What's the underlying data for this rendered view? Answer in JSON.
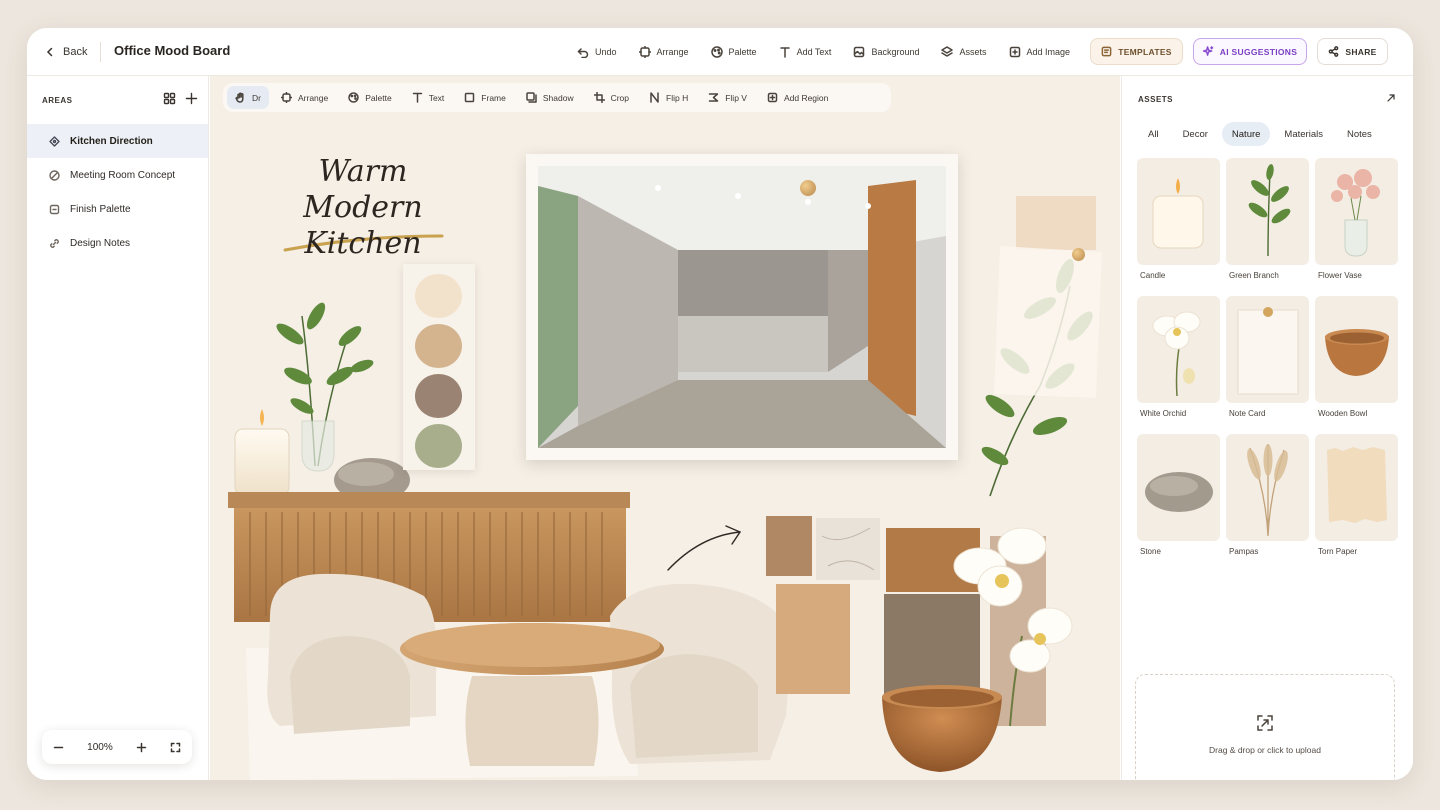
{
  "header": {
    "back_label": "Back",
    "title": "Office Mood Board",
    "tools": [
      {
        "label": "Undo",
        "icon": "undo-icon"
      },
      {
        "label": "Arrange",
        "icon": "arrange-icon"
      },
      {
        "label": "Palette",
        "icon": "palette-icon"
      },
      {
        "label": "Add Text",
        "icon": "text-icon"
      },
      {
        "label": "Background",
        "icon": "background-icon"
      },
      {
        "label": "Assets",
        "icon": "assets-icon"
      },
      {
        "label": "Add Image",
        "icon": "image-icon"
      }
    ],
    "templates_label": "TEMPLATES",
    "ai_label": "AI SUGGESTIONS",
    "share_label": "SHARE"
  },
  "left": {
    "areas_label": "AREAS",
    "items": [
      {
        "label": "Kitchen Direction",
        "active": true
      },
      {
        "label": "Meeting Room Concept"
      },
      {
        "label": "Finish Palette"
      },
      {
        "label": "Design Notes"
      }
    ],
    "zoom_label": "100%"
  },
  "canvas": {
    "tools": [
      "Dr",
      "Arrange",
      "Palette",
      "Text",
      "Frame",
      "Shadow",
      "Crop",
      "Flip H",
      "Flip V",
      "Add Region"
    ],
    "board_title_line1": "Warm Modern",
    "board_title_line2": "Kitchen",
    "swatches": [
      "#f3e2cb",
      "#d4b48f",
      "#9a8372",
      "#a8ae8b"
    ]
  },
  "right": {
    "assets_label": "ASSETS",
    "tabs": [
      "All",
      "Decor",
      "Nature",
      "Materials",
      "Notes"
    ],
    "active_tab": "Nature",
    "assets": [
      "Candle",
      "Green Branch",
      "Flower Vase",
      "White Orchid",
      "Note Card",
      "Wooden Bowl",
      "Stone",
      "Pampas",
      "Torn Paper"
    ],
    "upload_text": "Drag & drop or click to upload"
  },
  "colors": {
    "accent": "#7a3fc2",
    "active_nav": "#edf1f7",
    "canvas_bg": "#f5efe6"
  }
}
